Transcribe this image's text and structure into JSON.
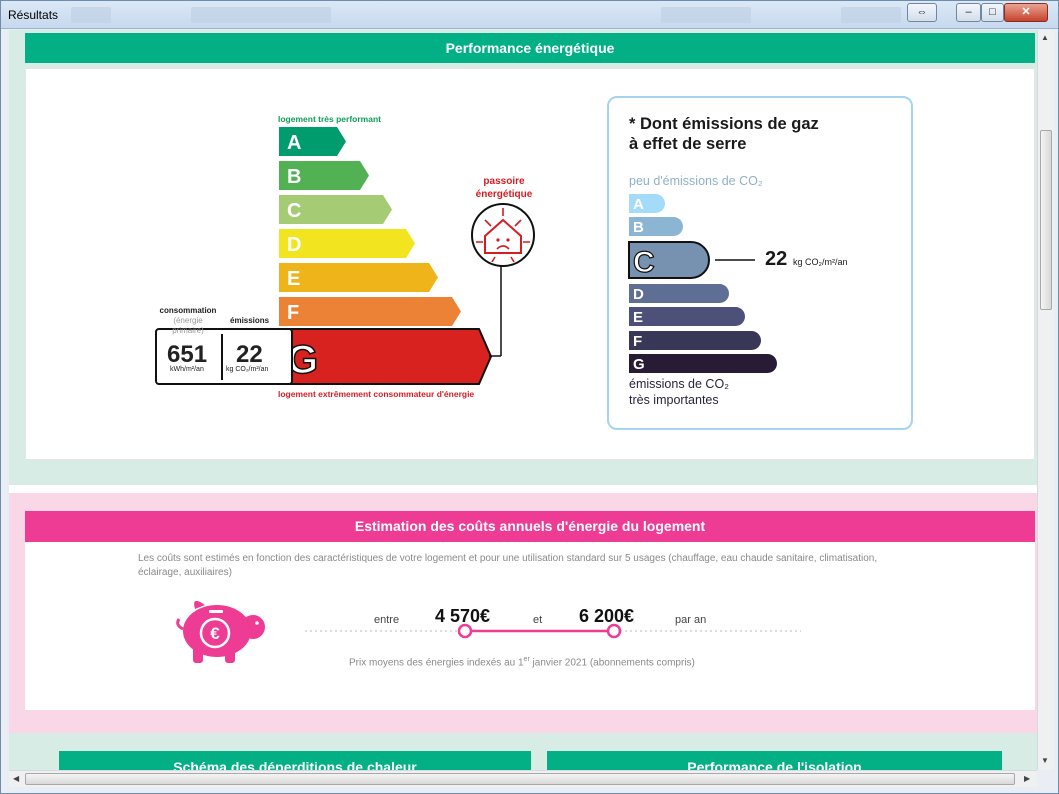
{
  "window": {
    "title": "Résultats"
  },
  "titlebar_buttons": {
    "restore": "⇔",
    "minimize": "–",
    "maximize": "□",
    "close": "✕"
  },
  "energy_section": {
    "title": "Performance énergétique",
    "dpe": {
      "top_label": "logement très performant",
      "bottom_label": "logement extrêmement consommateur d'énergie",
      "grades": [
        "A",
        "B",
        "C",
        "D",
        "E",
        "F",
        "G"
      ],
      "current_grade": "G",
      "consumption_label": "consommation",
      "consumption_sublabel": "(énergie primaire)",
      "emissions_label": "émissions",
      "consumption_value": "651",
      "consumption_unit": "kWh/m²/an",
      "emissions_value": "22",
      "emissions_unit": "kg CO₂/m²/an",
      "passoire_line1": "passoire",
      "passoire_line2": "énergétique",
      "colors": [
        "#009c6d",
        "#52b153",
        "#a5cc74",
        "#f2e51f",
        "#f0b41b",
        "#eb8235",
        "#d7221f"
      ]
    },
    "ges": {
      "title_line1": "* Dont émissions de gaz",
      "title_line2": "à effet de serre",
      "top_label": "peu d'émissions de CO₂",
      "bottom_line1": "émissions de CO₂",
      "bottom_line2": "très importantes",
      "grades": [
        "A",
        "B",
        "C",
        "D",
        "E",
        "F",
        "G"
      ],
      "current_grade": "C",
      "value": "22",
      "unit": "kg CO₂/m²/an",
      "colors": [
        "#a4dbf8",
        "#8cb4d3",
        "#7792b1",
        "#5f6e95",
        "#4d5179",
        "#393758",
        "#281b35"
      ]
    }
  },
  "cost_section": {
    "title": "Estimation des coûts annuels d'énergie du logement",
    "description": "Les coûts sont estimés en fonction des caractéristiques de votre logement et pour une utilisation standard sur 5 usages (chauffage, eau chaude sanitaire, climatisation, éclairage, auxiliaires)",
    "between_label": "entre",
    "min_value": "4 570€",
    "and_label": "et",
    "max_value": "6 200€",
    "per_year_label": "par an",
    "note_prefix": "Prix moyens des énergies indexés au 1",
    "note_sup": "er",
    "note_suffix": " janvier 2021 (abonnements compris)",
    "accent_color": "#ee3c94"
  },
  "bottom_cards": {
    "left_title": "Schéma des déperditions de chaleur",
    "right_title": "Performance de l'isolation"
  }
}
